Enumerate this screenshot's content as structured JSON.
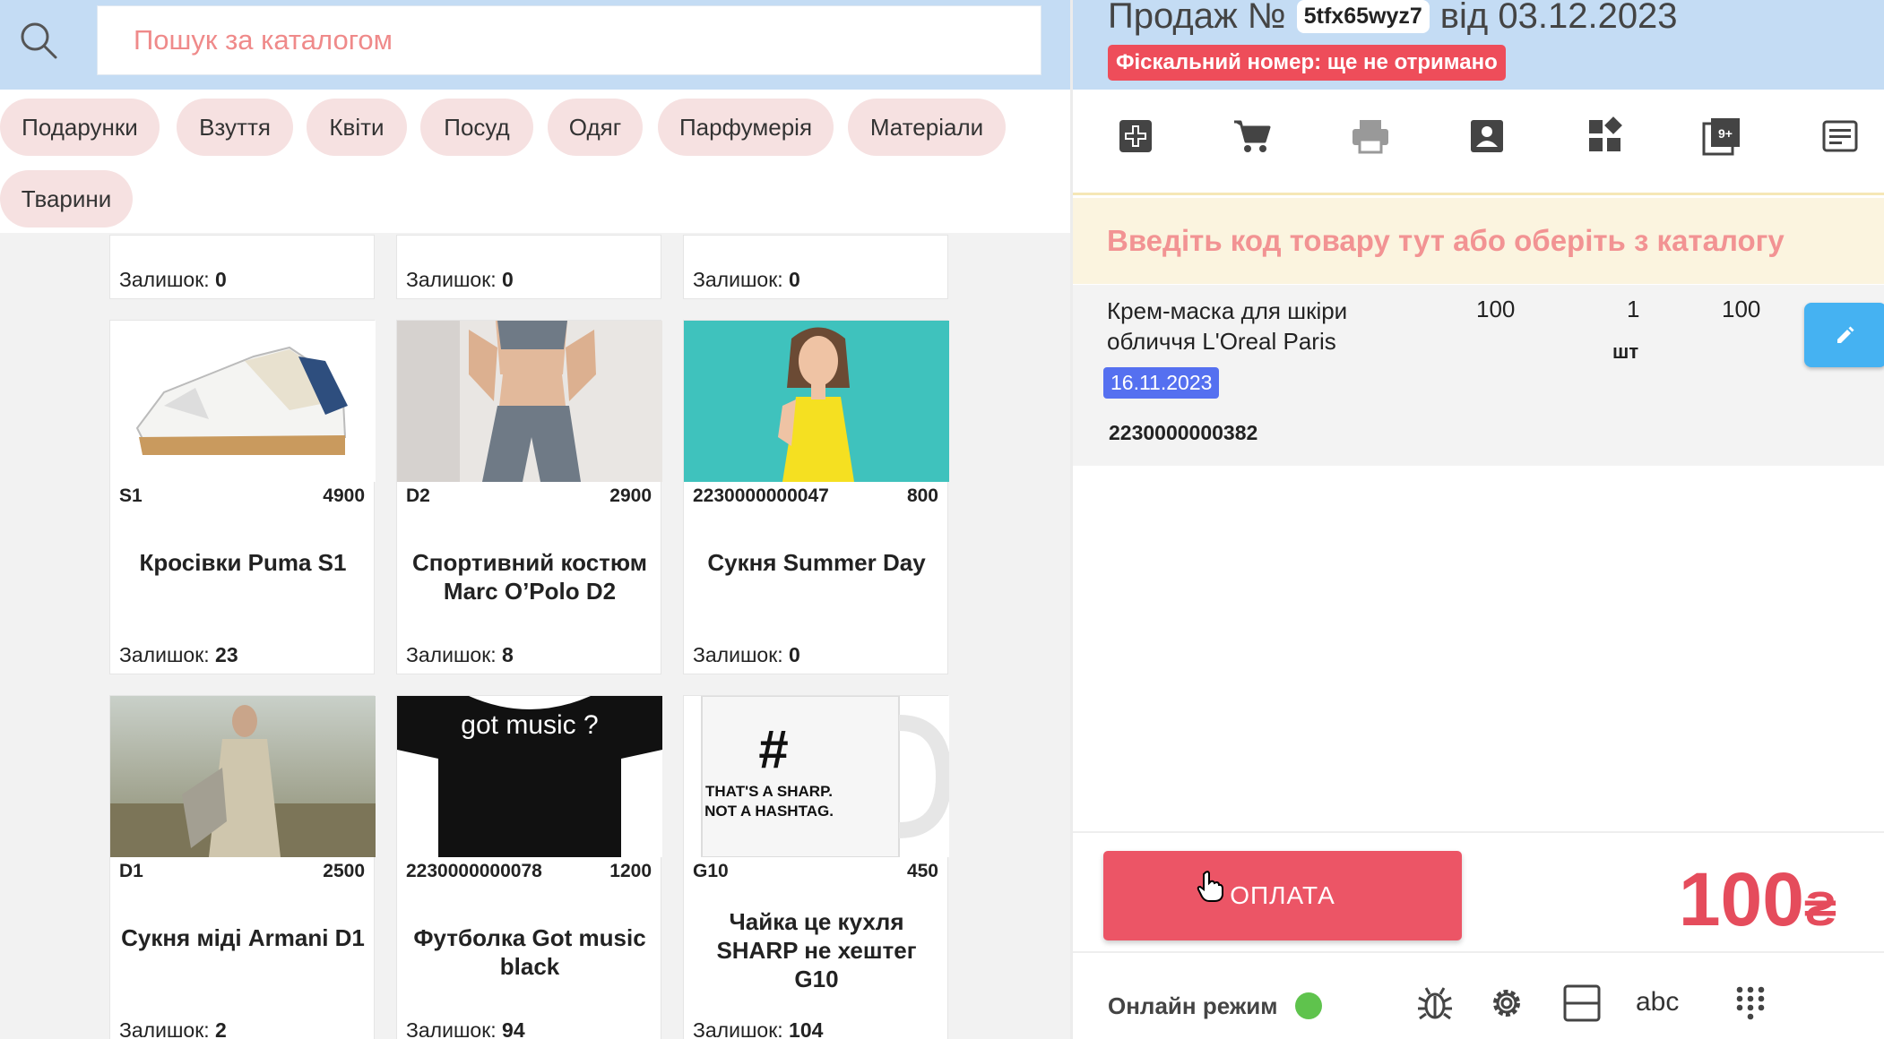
{
  "search": {
    "placeholder": "Пошук за каталогом",
    "icon": "search-icon"
  },
  "categories": [
    "Подарунки",
    "Взуття",
    "Квіти",
    "Посуд",
    "Одяг",
    "Парфумерія",
    "Матеріали",
    "Тварини"
  ],
  "top_cards": [
    {
      "stock_label": "Залишок:",
      "stock": "0"
    },
    {
      "stock_label": "Залишок:",
      "stock": "0"
    },
    {
      "stock_label": "Залишок:",
      "stock": "0"
    }
  ],
  "products": [
    {
      "code": "S1",
      "price": "4900",
      "name": "Кросівки Puma S1",
      "stock_label": "Залишок:",
      "stock": "23"
    },
    {
      "code": "D2",
      "price": "2900",
      "name": "Спортивний костюм Marc O’Polo D2",
      "stock_label": "Залишок:",
      "stock": "8"
    },
    {
      "code": "2230000000047",
      "price": "800",
      "name": "Сукня Summer Day",
      "stock_label": "Залишок:",
      "stock": "0"
    },
    {
      "code": "D1",
      "price": "2500",
      "name": "Сукня міді Armani D1",
      "stock_label": "Залишок:",
      "stock": "2"
    },
    {
      "code": "2230000000078",
      "price": "1200",
      "name": "Футболка Got music black",
      "stock_label": "Залишок:",
      "stock": "94"
    },
    {
      "code": "G10",
      "price": "450",
      "name": "Чайка це кухля SHARP не хештег G10",
      "stock_label": "Залишок:",
      "stock": "104"
    }
  ],
  "image_text": {
    "tshirt": "got music ?",
    "mug_hash": "#",
    "mug_line1": "THAT'S A SHARP.",
    "mug_line2": "NOT A HASHTAG."
  },
  "sale": {
    "prefix": "Продаж №",
    "id": "5tfx65wyz7",
    "date_text": "від 03.12.2023",
    "fiscal": "Фіскальний номер: ще не отримано"
  },
  "toolbar_icons": [
    "medical-box-icon",
    "cart-icon",
    "printer-icon",
    "contact-icon",
    "widgets-icon",
    "gallery-icon",
    "receipt-icon"
  ],
  "code_input": {
    "placeholder": "Введіть код товару тут або оберіть з каталогу"
  },
  "cart_item": {
    "name": "Крем-маска для шкіри обличчя L'Oreal Paris",
    "price": "100",
    "qty": "1",
    "unit": "шт",
    "sum": "100",
    "date": "16.11.2023",
    "barcode": "2230000000382"
  },
  "payment": {
    "button": "ОПЛАТА",
    "total": "100",
    "currency": "₴"
  },
  "status": {
    "online": "Онлайн режим",
    "icons": [
      "bug-icon",
      "settings-icon",
      "layout-icon",
      "abc-icon",
      "keypad-icon"
    ],
    "abc": "abc"
  },
  "colors": {
    "accent": "#ec5566",
    "topbar": "#c4dcf4",
    "chip": "#f6e1e1",
    "date_badge": "#5570f0",
    "edit_button": "#45b2f2",
    "online": "#5fc34d"
  }
}
